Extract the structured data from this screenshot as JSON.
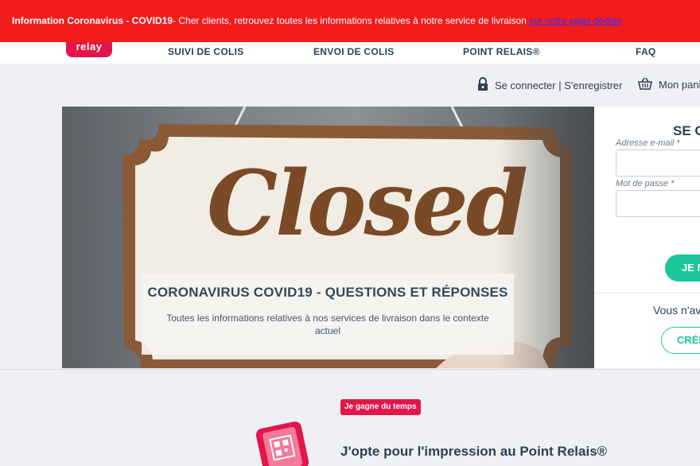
{
  "banner": {
    "bold": "Information Coronavirus - COVID19",
    "text": "- Cher clients, retrouvez toutes les informations relatives à notre service de livraison ",
    "link": "sur notre page dédiée"
  },
  "nav": {
    "logo": "relay",
    "items": [
      "SUIVI DE COLIS",
      "ENVOI DE COLIS",
      "POINT RELAIS®",
      "FAQ"
    ]
  },
  "account": {
    "login_link": "Se connecter | S'enregistrer",
    "cart": "Mon panier"
  },
  "hero": {
    "sign_text": "Closed",
    "title": "CORONAVIRUS COVID19 - QUESTIONS ET RÉPONSES",
    "text": "Toutes les informations relatives à nos services de livraison dans le contexte actuel"
  },
  "login": {
    "title": "SE CONNECTER",
    "email_label": "Adresse e-mail *",
    "password_label": "Mot de passe *",
    "submit": "JE ME CONNECTE",
    "no_account": "Vous n'avez pas de compte ?",
    "create": "CRÉER UN COMPTE"
  },
  "promo": {
    "tag": "Je gagne du temps",
    "title": "J'opte pour l'impression au Point Relais®"
  },
  "colors": {
    "banner_red": "#f21c1c",
    "brand_pink": "#e2164a",
    "accent_green": "#1cc59a",
    "link_blue": "#2d2dff"
  }
}
